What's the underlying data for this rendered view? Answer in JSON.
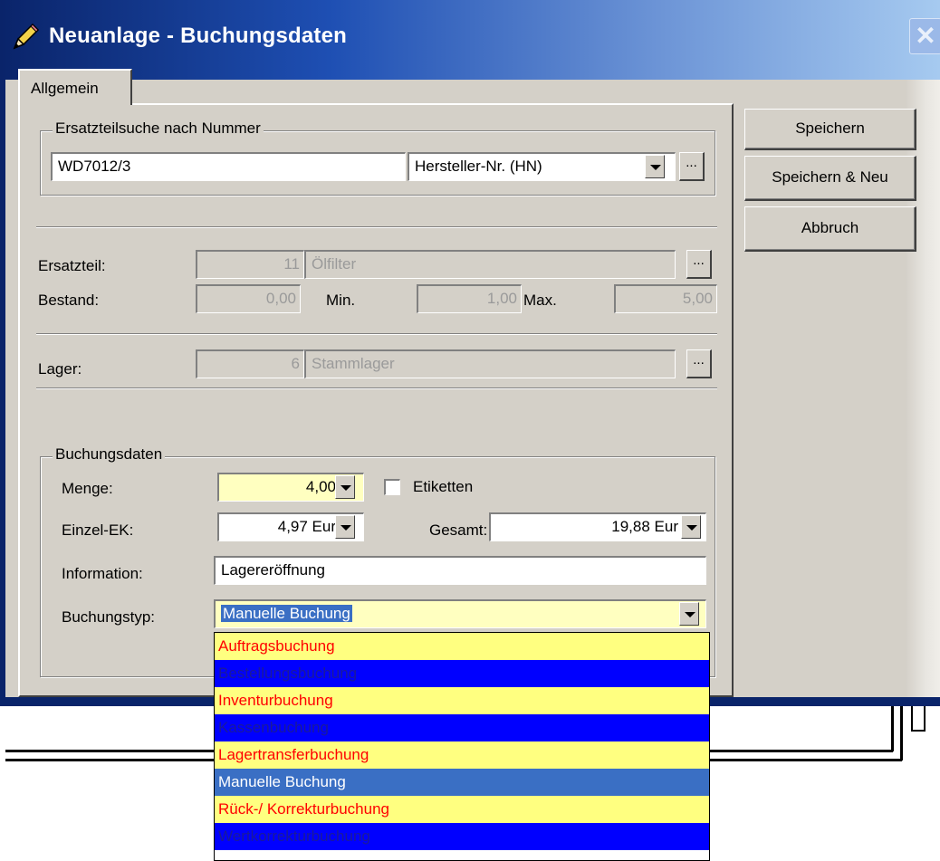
{
  "window": {
    "title": "Neuanlage - Buchungsdaten",
    "close_symbol": "✕"
  },
  "tabs": [
    {
      "label": "Allgemein"
    }
  ],
  "ersatzteilsuche": {
    "legend": "Ersatzteilsuche nach Nummer",
    "value": "WD7012/3",
    "type_value": "Hersteller-Nr. (HN)",
    "ellipsis": "..."
  },
  "ersatzteil": {
    "label": "Ersatzteil:",
    "number": "11",
    "name": "Ölfilter",
    "ellipsis": "..."
  },
  "bestand": {
    "label": "Bestand:",
    "value": "0,00",
    "min_label": "Min.",
    "min_value": "1,00",
    "max_label": "Max.",
    "max_value": "5,00"
  },
  "lager": {
    "label": "Lager:",
    "number": "6",
    "name": "Stammlager",
    "ellipsis": "..."
  },
  "buchungsdaten": {
    "legend": "Buchungsdaten",
    "menge_label": "Menge:",
    "menge_value": "4,00",
    "etiketten_label": "Etiketten",
    "etiketten_checked": false,
    "einzel_ek_label": "Einzel-EK:",
    "einzel_ek_value": "4,97 Eur",
    "gesamt_label": "Gesamt:",
    "gesamt_value": "19,88 Eur",
    "information_label": "Information:",
    "information_value": "Lagereröffnung",
    "buchungstyp_label": "Buchungstyp:",
    "buchungstyp_value": "Manuelle Buchung"
  },
  "buttons": {
    "save": "Speichern",
    "save_new": "Speichern & Neu",
    "cancel": "Abbruch"
  },
  "buchungstyp_options": [
    "Auftragsbuchung",
    "Bestellungsbuchung",
    "Inventurbuchung",
    "Kassenbuchung",
    "Lagertransferbuchung",
    "Manuelle Buchung",
    "Rück-/ Korrekturbuchung",
    "Wertkorrekturbuchung"
  ],
  "buchungstyp_selected_index": 5,
  "icons": {
    "title": "pencil-icon"
  },
  "colors": {
    "titlebar_start": "#0a246a",
    "titlebar_end": "#a6caf0",
    "dialog_bg": "#d4d0c8",
    "option_even_bg": "#ffff80",
    "option_even_text": "#ff0000",
    "option_odd_bg": "#0000ff",
    "option_selected_bg": "#3a6fc4"
  }
}
